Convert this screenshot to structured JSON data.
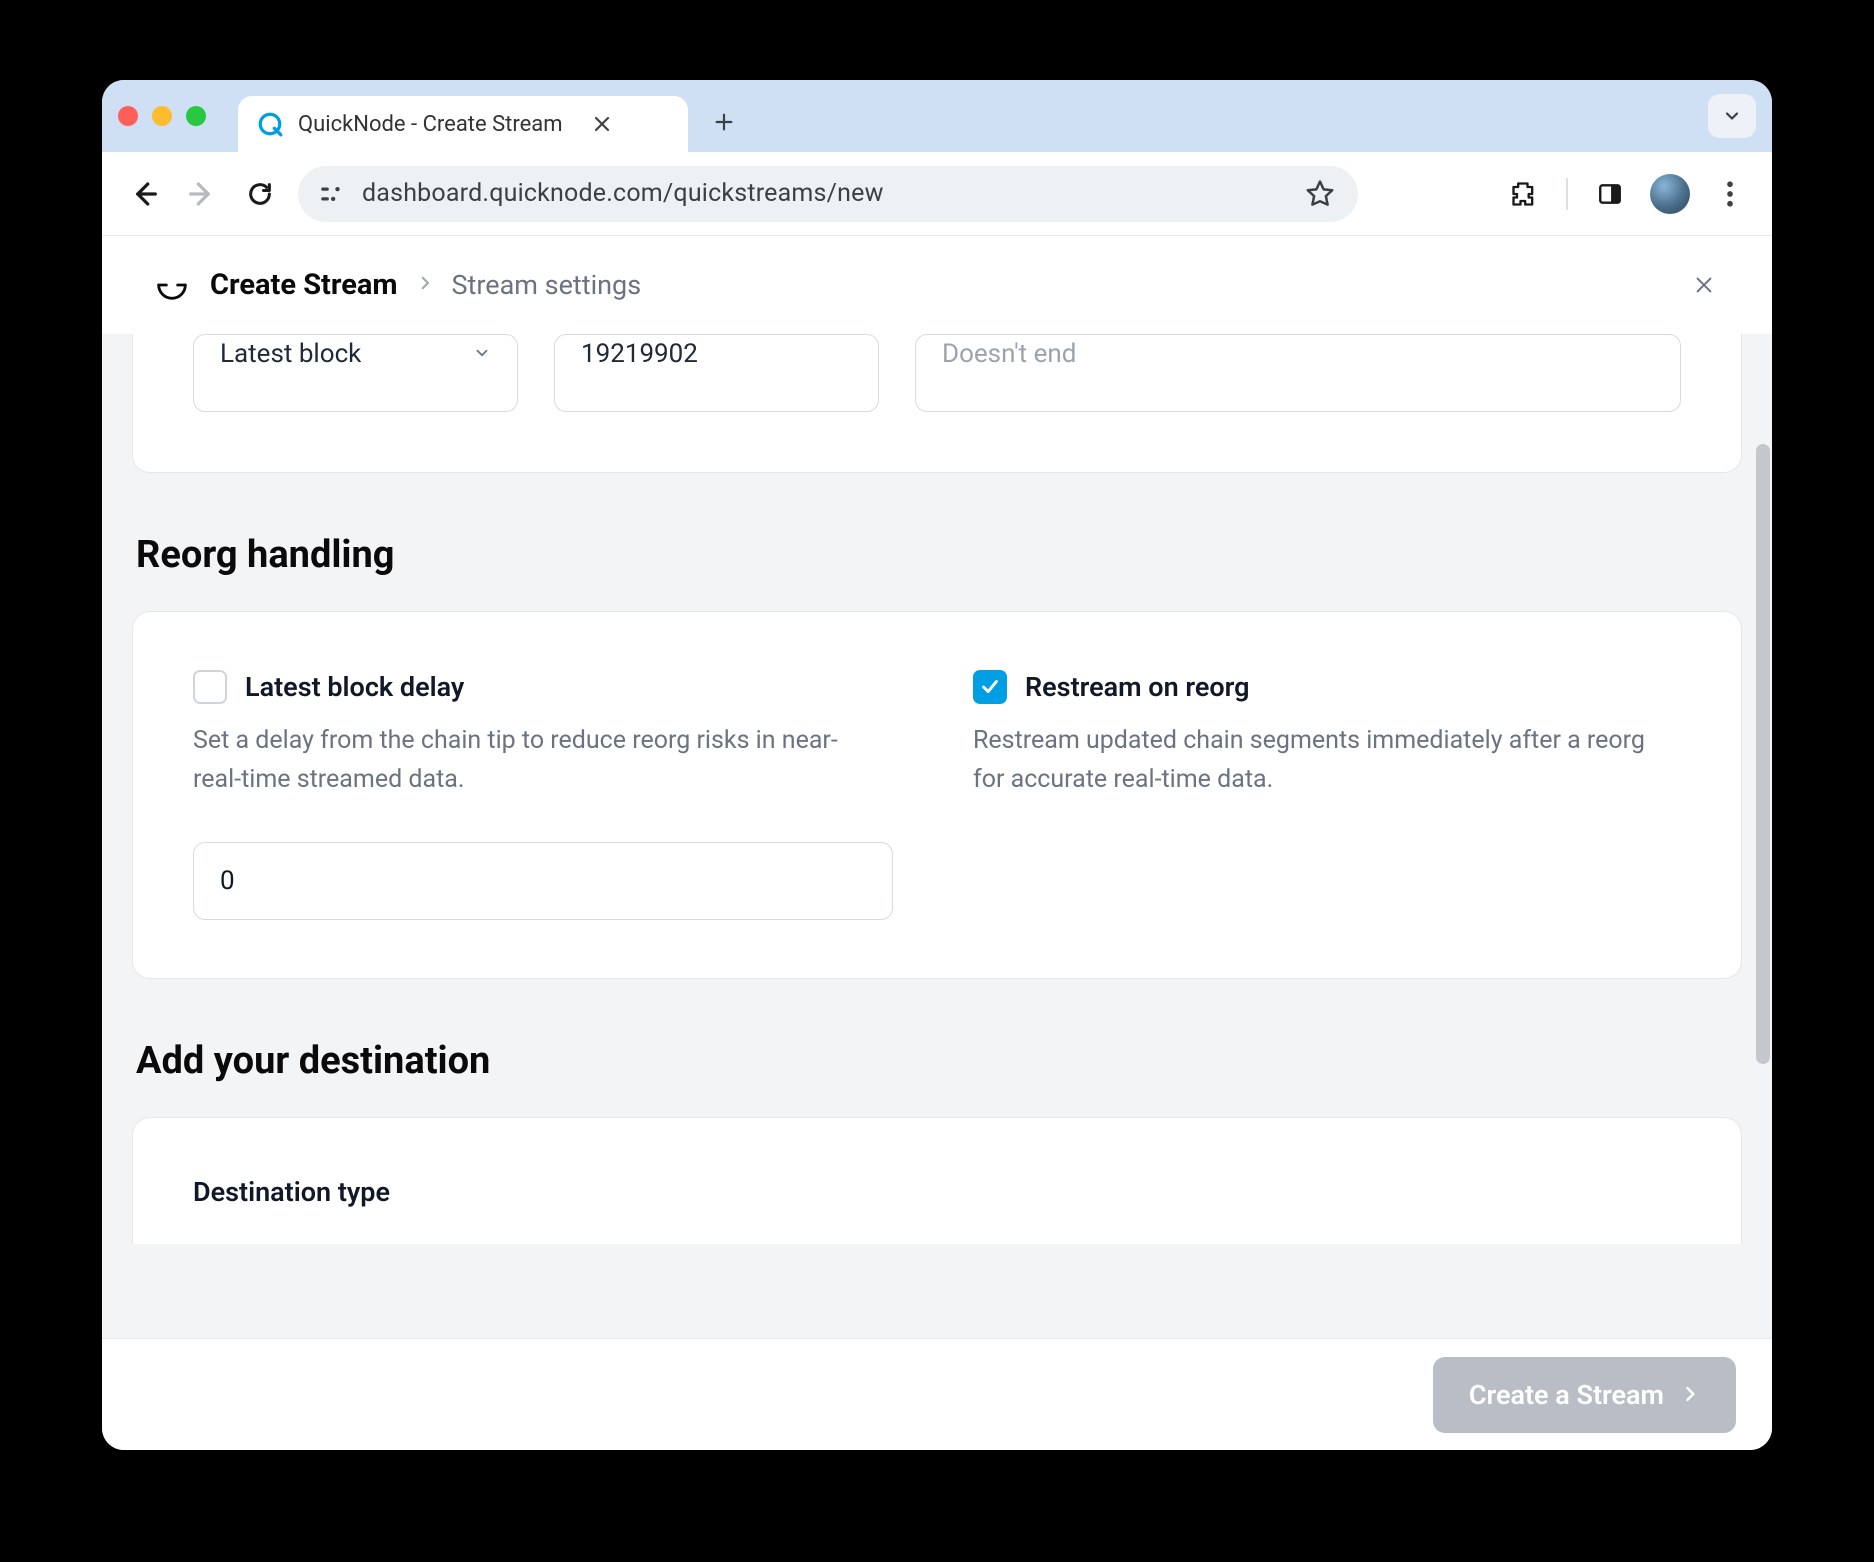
{
  "browser": {
    "tab_title": "QuickNode - Create Stream",
    "url": "dashboard.quicknode.com/quickstreams/new"
  },
  "header": {
    "title": "Create Stream",
    "subtitle": "Stream settings"
  },
  "stream_range": {
    "start_select": "Latest block",
    "block_number": "19219902",
    "end_label": "Doesn't end"
  },
  "reorg": {
    "section_title": "Reorg handling",
    "delay": {
      "label": "Latest block delay",
      "description": "Set a delay from the chain tip to reduce reorg risks in near-real-time streamed data.",
      "value": "0",
      "checked": false
    },
    "restream": {
      "label": "Restream on reorg",
      "description": "Restream updated chain segments immediately after a reorg for accurate real-time data.",
      "checked": true
    }
  },
  "destination": {
    "section_title": "Add your destination",
    "type_label": "Destination type"
  },
  "cta_label": "Create a Stream"
}
